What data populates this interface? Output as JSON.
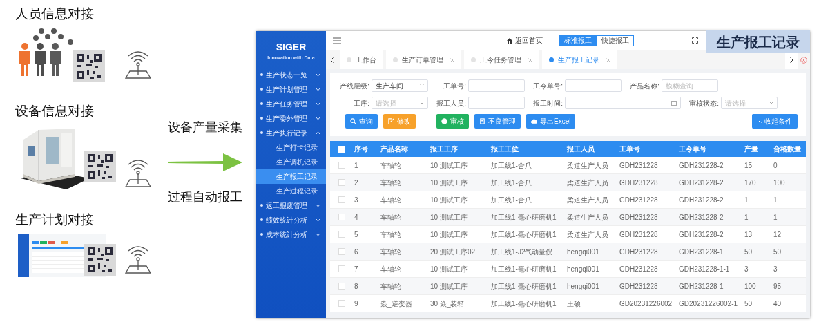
{
  "slide": {
    "sections": [
      {
        "title": "人员信息对接",
        "kind": "people"
      },
      {
        "title": "设备信息对接",
        "kind": "machine"
      },
      {
        "title": "生产计划对接",
        "kind": "plan"
      }
    ],
    "flow": {
      "top_label": "设备产量采集",
      "bottom_label": "过程自动报工"
    },
    "overlay_title": "生产报工记录"
  },
  "app": {
    "sidebar": {
      "logo": "SIGER",
      "tagline": "Innovation with Data",
      "items": [
        {
          "label": "生产状态一览",
          "expanded": false,
          "selected": false
        },
        {
          "label": "生产计划管理",
          "expanded": false,
          "selected": false
        },
        {
          "label": "生产任务管理",
          "expanded": false,
          "selected": false
        },
        {
          "label": "生产委外管理",
          "expanded": false,
          "selected": false
        },
        {
          "label": "生产执行记录",
          "expanded": true,
          "selected": false,
          "children": [
            {
              "label": "生产打卡记录",
              "selected": false
            },
            {
              "label": "生产调机记录",
              "selected": false
            },
            {
              "label": "生产报工记录",
              "selected": true
            },
            {
              "label": "生产过程记录",
              "selected": false
            }
          ]
        },
        {
          "label": "返工报废管理",
          "expanded": false,
          "selected": false
        },
        {
          "label": "绩效统计分析",
          "expanded": false,
          "selected": false
        },
        {
          "label": "成本统计分析",
          "expanded": false,
          "selected": false
        }
      ]
    },
    "topbar": {
      "home": "返回首页",
      "modes": [
        {
          "label": "标准报工",
          "selected": true
        },
        {
          "label": "快捷报工",
          "selected": false
        }
      ]
    },
    "tabs": [
      {
        "label": "工作台",
        "selected": false,
        "closable": false
      },
      {
        "label": "生产订单管理",
        "selected": false,
        "closable": true
      },
      {
        "label": "工令任务管理",
        "selected": false,
        "closable": true
      },
      {
        "label": "生产报工记录",
        "selected": true,
        "closable": true
      }
    ],
    "filter_rows": [
      [
        {
          "label": "产线层级:",
          "kind": "select",
          "value": "生产车间"
        },
        {
          "label": "工单号:",
          "kind": "input"
        },
        {
          "label": "工令单号:",
          "kind": "input"
        },
        {
          "label": "产品名称:",
          "kind": "input",
          "placeholder": "模糊查询"
        }
      ],
      [
        {
          "label": "工序:",
          "kind": "select",
          "placeholder": "请选择"
        },
        {
          "label": "报工人员:",
          "kind": "input"
        },
        {
          "label": "报工时间:",
          "kind": "date"
        },
        {
          "label": "审核状态:",
          "kind": "select",
          "placeholder": "请选择"
        }
      ]
    ],
    "buttons": [
      {
        "label": "查询",
        "kind": "search",
        "color": "#2d8cf0"
      },
      {
        "label": "修改",
        "kind": "edit",
        "color": "#f7a12a"
      },
      {
        "label": "审核",
        "kind": "approve",
        "color": "#21b25f"
      },
      {
        "label": "不良管理",
        "kind": "document",
        "color": "#2d8cf0"
      },
      {
        "label": "导出Excel",
        "kind": "export",
        "color": "#2d8cf0"
      }
    ],
    "collapse_button": "收起条件",
    "table": {
      "select_all_checked": false,
      "columns": [
        "序号",
        "产品名称",
        "报工工序",
        "报工工位",
        "报工人员",
        "工单号",
        "工令单号",
        "产量",
        "合格数量"
      ],
      "rows": [
        {
          "checked": false,
          "cells": [
            "1",
            "车轴轮",
            "10 测试工序",
            "加工线1-合爪",
            "柔道生产人员",
            "GDH231228",
            "GDH231228-2",
            "15",
            "0"
          ]
        },
        {
          "checked": false,
          "cells": [
            "2",
            "车轴轮",
            "10 测试工序",
            "加工线1-合爪",
            "柔道生产人员",
            "GDH231228",
            "GDH231228-2",
            "170",
            "100"
          ]
        },
        {
          "checked": false,
          "cells": [
            "3",
            "车轴轮",
            "10 测试工序",
            "加工线1-合爪",
            "柔道生产人员",
            "GDH231228",
            "GDH231228-2",
            "1",
            "1"
          ]
        },
        {
          "checked": false,
          "cells": [
            "4",
            "车轴轮",
            "10 测试工序",
            "加工线1-毫心研磨机1",
            "柔道生产人员",
            "GDH231228",
            "GDH231228-2",
            "1",
            "1"
          ]
        },
        {
          "checked": false,
          "cells": [
            "5",
            "车轴轮",
            "10 测试工序",
            "加工线1-毫心研磨机1",
            "柔道生产人员",
            "GDH231228",
            "GDH231228-2",
            "13",
            "12"
          ]
        },
        {
          "checked": false,
          "cells": [
            "6",
            "车轴轮",
            "20 测试工序02",
            "加工线1-J2气动量仪",
            "hengqi001",
            "GDH231228",
            "GDH231228-1",
            "50",
            "50"
          ]
        },
        {
          "checked": false,
          "cells": [
            "7",
            "车轴轮",
            "10 测试工序",
            "加工线1-毫心研磨机1",
            "hengqi001",
            "GDH231228",
            "GDH231228-1-1",
            "3",
            "3"
          ]
        },
        {
          "checked": false,
          "cells": [
            "8",
            "车轴轮",
            "10 测试工序",
            "加工线1-毫心研磨机1",
            "hengqi001",
            "GDH231228",
            "GDH231228-1",
            "100",
            "95"
          ]
        },
        {
          "checked": false,
          "cells": [
            "9",
            "焱_逆变器",
            "30 焱_装箱",
            "加工线1-毫心研磨机1",
            "王硕",
            "GD20231226002",
            "GD20231226002-1",
            "50",
            "40"
          ]
        }
      ]
    }
  }
}
